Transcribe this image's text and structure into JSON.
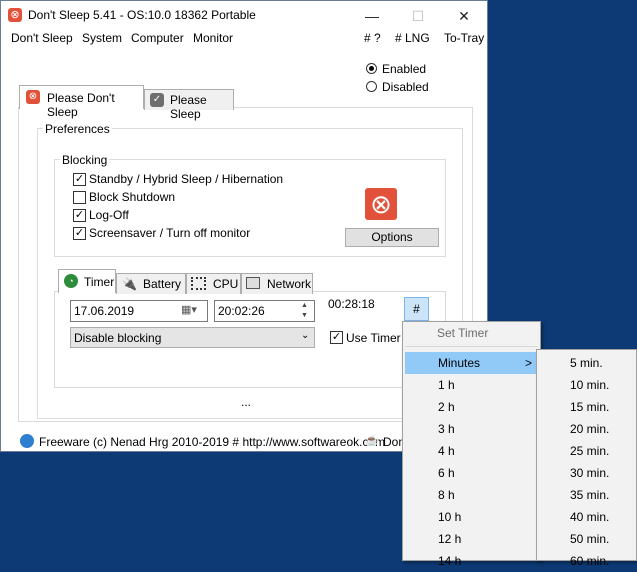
{
  "window": {
    "title": "Don't Sleep 5.41 - OS:10.0 18362 Portable",
    "title_icon": "⊗",
    "controls": {
      "minimize": "—",
      "maximize": "☐",
      "close": "✕"
    }
  },
  "menubar": {
    "left": [
      "Don't Sleep",
      "System",
      "Computer",
      "Monitor"
    ],
    "right": [
      "# ?",
      "# LNG",
      "To-Tray"
    ]
  },
  "mode": {
    "enabled_label": "Enabled",
    "disabled_label": "Disabled",
    "selected": "Enabled"
  },
  "main_tabs": [
    {
      "label": "Please Don't Sleep",
      "icon": "stop-icon",
      "active": true
    },
    {
      "label": "Please Sleep",
      "icon": "sleep-icon",
      "active": false
    }
  ],
  "preferences": {
    "label": "Preferences",
    "blocking": {
      "label": "Blocking",
      "items": [
        {
          "label": "Standby / Hybrid Sleep / Hibernation",
          "checked": true
        },
        {
          "label": "Block Shutdown",
          "checked": false
        },
        {
          "label": "Log-Off",
          "checked": true
        },
        {
          "label": "Screensaver / Turn off monitor",
          "checked": true
        }
      ],
      "big_icon": "⊗",
      "options_label": "Options"
    }
  },
  "sub_tabs": [
    {
      "label": "Timer",
      "icon": "clock-icon",
      "active": true
    },
    {
      "label": "Battery",
      "icon": "battery-icon",
      "active": false
    },
    {
      "label": "CPU",
      "icon": "cpu-icon",
      "active": false
    },
    {
      "label": "Network",
      "icon": "network-icon",
      "active": false
    }
  ],
  "timer": {
    "date": "17.06.2019",
    "time": "20:02:26",
    "countdown": "00:28:18",
    "hash_label": "#",
    "action": "Disable blocking",
    "use_timer_label": "Use Timer",
    "use_timer_checked": true
  },
  "ellipsis": "...",
  "status": {
    "text": "Freeware (c) Nenad Hrg 2010-2019 # http://www.softwareok.com",
    "donate": "Don"
  },
  "context_menu": {
    "header": "Set Timer",
    "items": [
      "Minutes",
      "1 h",
      "2 h",
      "3 h",
      "4 h",
      "6 h",
      "8 h",
      "10 h",
      "12 h",
      "14 h"
    ],
    "highlighted": "Minutes",
    "submenu_arrow": ">"
  },
  "submenu": {
    "items": [
      "5 min.",
      "10 min.",
      "15 min.",
      "20 min.",
      "25 min.",
      "30 min.",
      "35 min.",
      "40 min.",
      "50 min.",
      "60 min."
    ]
  },
  "colors": {
    "desktop": "#0d3a74",
    "accent_red": "#e2523b",
    "highlight": "#91c9f7"
  }
}
